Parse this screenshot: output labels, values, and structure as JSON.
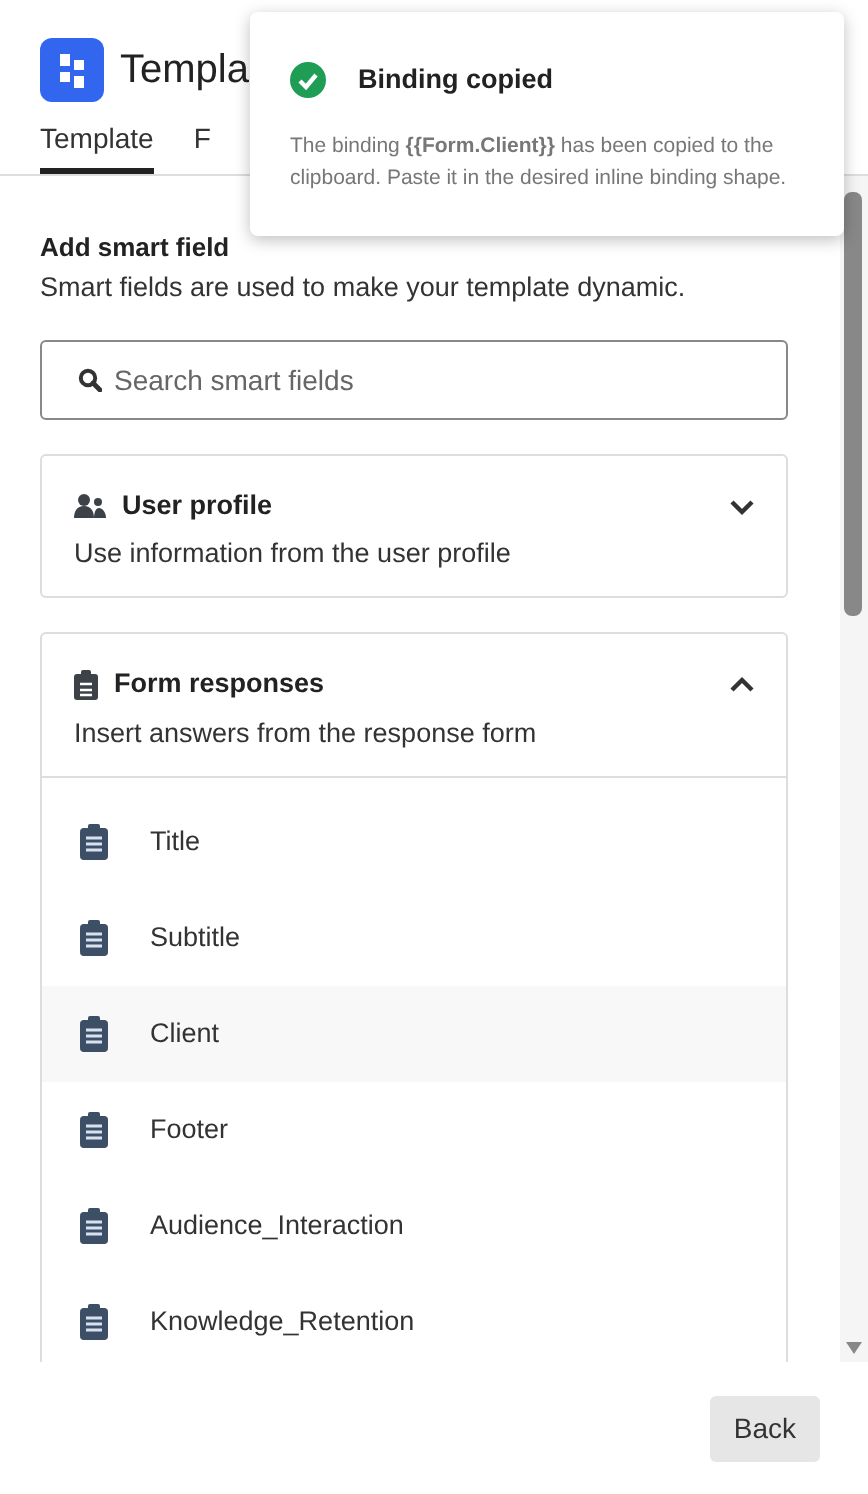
{
  "header": {
    "title": "Templa"
  },
  "tabs": [
    {
      "label": "Template",
      "selected": true
    },
    {
      "label": "F",
      "selected": false
    }
  ],
  "intro": {
    "heading": "Add smart field",
    "text": "Smart fields are used to make your template dynamic."
  },
  "search": {
    "placeholder": "Search smart fields"
  },
  "groups": [
    {
      "kind": "users",
      "title": "User profile",
      "text": "Use information from the user profile",
      "expanded": false
    },
    {
      "kind": "form",
      "title": "Form responses",
      "text": "Insert answers from the response form",
      "expanded": true,
      "items": [
        {
          "label": "Title",
          "selected": false
        },
        {
          "label": "Subtitle",
          "selected": false
        },
        {
          "label": "Client",
          "selected": true
        },
        {
          "label": "Footer",
          "selected": false
        },
        {
          "label": "Audience_Interaction",
          "selected": false
        },
        {
          "label": "Knowledge_Retention",
          "selected": false
        }
      ]
    }
  ],
  "toast": {
    "title": "Binding copied",
    "text": "The binding **{{Form.Client}}** has been copied to the clipboard. Paste it in the desired inline binding shape."
  },
  "footer": {
    "button": "Back"
  }
}
